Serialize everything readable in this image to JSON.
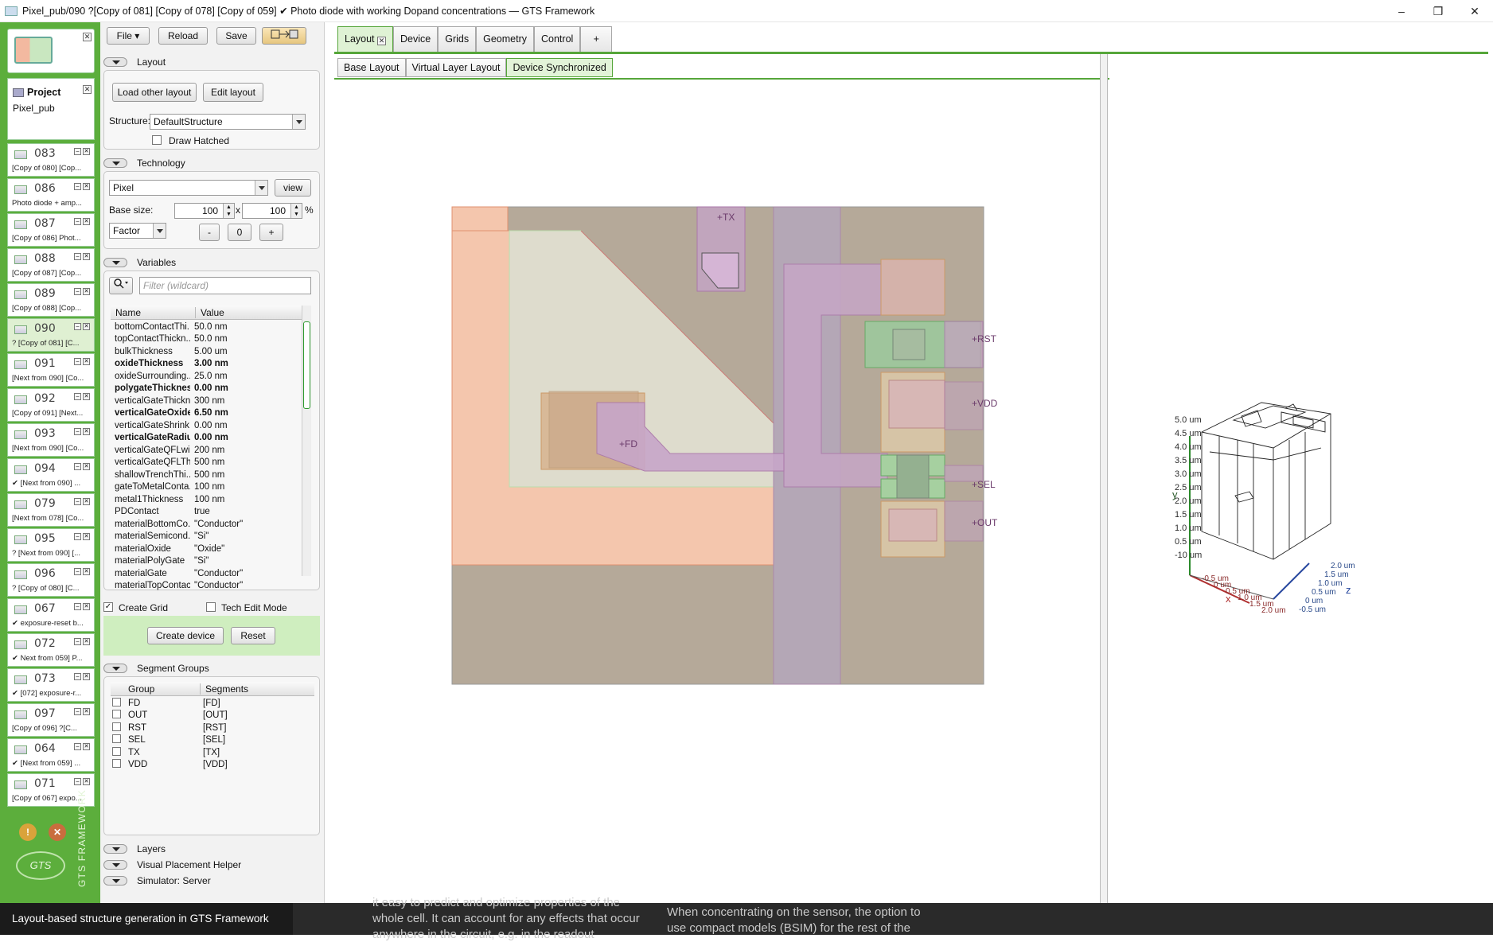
{
  "window": {
    "title": "Pixel_pub/090 ?[Copy of 081] [Copy of 078] [Copy of 059] ✔ Photo diode with working Dopand concentrations — GTS Framework",
    "min": "–",
    "max": "❐",
    "close": "✕"
  },
  "project": {
    "header": "Project",
    "name": "Pixel_pub"
  },
  "project_items": [
    {
      "num": "083",
      "desc": "[Copy of 080] [Cop..."
    },
    {
      "num": "086",
      "desc": "Photo diode + amp..."
    },
    {
      "num": "087",
      "desc": "[Copy of 086] Phot..."
    },
    {
      "num": "088",
      "desc": "[Copy of 087] [Cop..."
    },
    {
      "num": "089",
      "desc": "[Copy of 088] [Cop..."
    },
    {
      "num": "090",
      "desc": "? [Copy of 081] [C..."
    },
    {
      "num": "091",
      "desc": "[Next from 090] [Co..."
    },
    {
      "num": "092",
      "desc": "[Copy of 091] [Next..."
    },
    {
      "num": "093",
      "desc": "[Next from 090] [Co..."
    },
    {
      "num": "094",
      "desc": "✔ [Next from 090] ..."
    },
    {
      "num": "079",
      "desc": "[Next from 078] [Co..."
    },
    {
      "num": "095",
      "desc": "? [Next from 090] [..."
    },
    {
      "num": "096",
      "desc": "? [Copy of 080] [C..."
    },
    {
      "num": "067",
      "desc": "✔ exposure-reset b..."
    },
    {
      "num": "072",
      "desc": "✔ Next from 059] P..."
    },
    {
      "num": "073",
      "desc": "✔ [072] exposure-r..."
    },
    {
      "num": "097",
      "desc": "[Copy of 096] ?[C..."
    },
    {
      "num": "064",
      "desc": "✔ [Next from 059] ..."
    },
    {
      "num": "071",
      "desc": "[Copy of 067] expo..."
    }
  ],
  "brand": {
    "vertical": "GTS FRAMEWORK",
    "logo": "GTS",
    "warn": "!",
    "err": "✕"
  },
  "toolbar": {
    "file": "File ▾",
    "reload": "Reload",
    "save": "Save"
  },
  "layout": {
    "header": "Layout",
    "load_other": "Load other layout",
    "edit": "Edit layout",
    "structure_label": "Structure:",
    "structure_value": "DefaultStructure",
    "draw_hatched": "Draw Hatched"
  },
  "technology": {
    "header": "Technology",
    "tech_value": "Pixel",
    "view": "view",
    "base_size_label": "Base size:",
    "base_x": "100",
    "x_sep": "x",
    "base_y": "100",
    "unit": "%",
    "mode": "Factor",
    "minus": "-",
    "zero": "0",
    "plus": "+"
  },
  "variables": {
    "header": "Variables",
    "filter_placeholder": "Filter (wildcard)",
    "col_name": "Name",
    "col_value": "Value",
    "rows": [
      {
        "name": "bottomContactThi...",
        "value": "50.0 nm",
        "bold": false
      },
      {
        "name": "topContactThickn...",
        "value": "50.0 nm",
        "bold": false
      },
      {
        "name": "bulkThickness",
        "value": "5.00 um",
        "bold": false
      },
      {
        "name": "oxideThickness",
        "value": "3.00 nm",
        "bold": true
      },
      {
        "name": "oxideSurrounding...",
        "value": "25.0 nm",
        "bold": false
      },
      {
        "name": "polygateThickness",
        "value": "0.00 nm",
        "bold": true
      },
      {
        "name": "verticalGateThickn...",
        "value": "300 nm",
        "bold": false
      },
      {
        "name": "verticalGateOxide...",
        "value": "6.50 nm",
        "bold": true
      },
      {
        "name": "verticalGateShrink",
        "value": "0.00 nm",
        "bold": false
      },
      {
        "name": "verticalGateRadius",
        "value": "0.00 nm",
        "bold": true
      },
      {
        "name": "verticalGateQFLwi...",
        "value": "200 nm",
        "bold": false
      },
      {
        "name": "verticalGateQFLTh...",
        "value": "500 nm",
        "bold": false
      },
      {
        "name": "shallowTrenchThi...",
        "value": "500 nm",
        "bold": false
      },
      {
        "name": "gateToMetalConta...",
        "value": "100 nm",
        "bold": false
      },
      {
        "name": "metal1Thickness",
        "value": "100 nm",
        "bold": false
      },
      {
        "name": "PDContact",
        "value": "true",
        "bold": false
      },
      {
        "name": "materialBottomCo...",
        "value": "\"Conductor\"",
        "bold": false
      },
      {
        "name": "materialSemicond...",
        "value": "\"Si\"",
        "bold": false
      },
      {
        "name": "materialOxide",
        "value": "\"Oxide\"",
        "bold": false
      },
      {
        "name": "materialPolyGate",
        "value": "\"Si\"",
        "bold": false
      },
      {
        "name": "materialGate",
        "value": "\"Conductor\"",
        "bold": false
      },
      {
        "name": "materialTopContact",
        "value": "\"Conductor\"",
        "bold": false
      }
    ],
    "create_grid": "Create Grid",
    "tech_edit_mode": "Tech Edit Mode",
    "create_device": "Create device",
    "reset": "Reset"
  },
  "segments": {
    "header": "Segment Groups",
    "col_group": "Group",
    "col_segments": "Segments",
    "rows": [
      {
        "group": "FD",
        "segment": "[FD]"
      },
      {
        "group": "OUT",
        "segment": "[OUT]"
      },
      {
        "group": "RST",
        "segment": "[RST]"
      },
      {
        "group": "SEL",
        "segment": "[SEL]"
      },
      {
        "group": "TX",
        "segment": "[TX]"
      },
      {
        "group": "VDD",
        "segment": "[VDD]"
      }
    ]
  },
  "collapsed": {
    "layers": "Layers",
    "visual": "Visual Placement Helper",
    "simulator": "Simulator: Server"
  },
  "tabs": {
    "layout": "Layout",
    "device": "Device",
    "grids": "Grids",
    "geometry": "Geometry",
    "control": "Control",
    "add": "+"
  },
  "subtabs": {
    "base": "Base Layout",
    "virtual": "Virtual Layer Layout",
    "sync": "Device Synchronized"
  },
  "canvas_labels": {
    "tx": "+TX",
    "rst": "+RST",
    "vdd": "+VDD",
    "fd": "+FD",
    "sel": "+SEL",
    "out": "+OUT"
  },
  "view3d": {
    "y_ticks": [
      "5.0 um",
      "4.5 um",
      "4.0 um",
      "3.5 um",
      "3.0 um",
      "2.5 um",
      "2.0 um",
      "1.5 um",
      "1.0 um",
      "0.5 um",
      "-10 um"
    ],
    "x_ticks": [
      "-0.5 um",
      "0 um",
      "0.5 um",
      "1.0 um",
      "1.5 um",
      "2.0 um"
    ],
    "z_ticks": [
      "2.0 um",
      "1.5 um",
      "1.0 um",
      "0.5 um",
      "0 um",
      "-0.5 um"
    ],
    "x_axis": "x",
    "y_axis": "y",
    "z_axis": "z"
  },
  "caption": "Layout-based structure generation in GTS Framework",
  "background_text": {
    "left1": "it easy to predict and optimize properties of the",
    "left2": "whole cell. It can account for any effects that occur",
    "left3": "anywhere in the circuit, e.g. in the readout",
    "right1": "When concentrating on the sensor, the option to",
    "right2": "use compact models (BSIM) for the rest of the"
  },
  "colors": {
    "accent": "#5cae3c",
    "chip_bg": "#b5a999"
  }
}
